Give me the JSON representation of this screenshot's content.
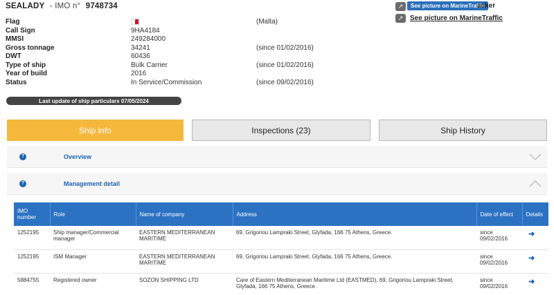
{
  "header": {
    "ship_name": "SEALADY",
    "imo_label": "- IMO n°",
    "imo_number": "9748734"
  },
  "external_links": {
    "tooltip": "See picture on MarineTraffic",
    "tracker_text": "acker",
    "picture_link": "See picture on MarineTraffic"
  },
  "particulars": [
    {
      "label": "Flag",
      "value": "",
      "since": "(Malta)",
      "flag": true
    },
    {
      "label": "Call Sign",
      "value": "9HA4184",
      "since": ""
    },
    {
      "label": "MMSI",
      "value": "249284000",
      "since": ""
    },
    {
      "label": "Gross tonnage",
      "value": "34241",
      "since": "(since 01/02/2016)"
    },
    {
      "label": "DWT",
      "value": "60436",
      "since": ""
    },
    {
      "label": "Type of ship",
      "value": "Bulk Carrier",
      "since": "(since 01/02/2016)"
    },
    {
      "label": "Year of build",
      "value": "2016",
      "since": ""
    },
    {
      "label": "Status",
      "value": "In Service/Commission",
      "since": "(since 09/02/2016)"
    }
  ],
  "last_update": "Last update of ship particulars 07/05/2024",
  "tabs": [
    {
      "label": "Ship info",
      "active": true
    },
    {
      "label": "Inspections (23)",
      "active": false
    },
    {
      "label": "Ship History",
      "active": false
    }
  ],
  "sections": {
    "overview": {
      "title": "Overview",
      "expanded": false
    },
    "management": {
      "title": "Management detail",
      "expanded": true
    }
  },
  "table": {
    "headers": [
      "IMO number",
      "Role",
      "Name of company",
      "Address",
      "Date of effect",
      "Details"
    ],
    "rows": [
      {
        "imo": "1252195",
        "role": "Ship manager/Commercial manager",
        "company": "EASTERN MEDITERRANEAN MARITIME",
        "address": "69, Grigoriou Lampraki Street, Glyfada, 166 75 Athens, Greece.",
        "date": "since 09/02/2016"
      },
      {
        "imo": "1252195",
        "role": "ISM Manager",
        "company": "EASTERN MEDITERRANEAN MARITIME",
        "address": "69, Grigoriou Lampraki Street, Glyfada, 166 75 Athens, Greece.",
        "date": "since 09/02/2016"
      },
      {
        "imo": "5884755",
        "role": "Registered owner",
        "company": "SOZON SHIPPING LTD",
        "address": "Care of Eastern Mediterranean Maritime Ltd (EASTMED), 69, Grigoriou Lampraki Street, Glyfada, 166 75 Athens, Greece.",
        "date": "since 09/02/2016"
      }
    ]
  },
  "colors": {
    "active_tab": "#f5b83d",
    "table_header": "#2b72c2",
    "link_blue": "#1c62b0"
  }
}
